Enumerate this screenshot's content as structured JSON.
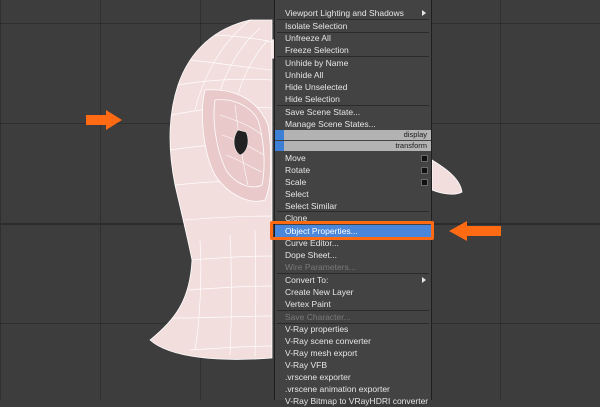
{
  "colors": {
    "menu_bg": "#434343",
    "menu_text": "#e6e6e6",
    "disabled_text": "#7a7a7a",
    "highlight": "#4a86d9",
    "quad_header": "#b3b3b3",
    "annotation": "#ff6a13",
    "viewport_bg": "#3d3d3d"
  },
  "viewport": {
    "model": "wireframe-head-icon"
  },
  "menu": {
    "items": {
      "viewport_lighting": "Viewport Lighting and Shadows",
      "isolate_selection": "Isolate Selection",
      "unfreeze_all": "Unfreeze All",
      "freeze_selection": "Freeze Selection",
      "unhide_by_name": "Unhide by Name",
      "unhide_all": "Unhide All",
      "hide_unselected": "Hide Unselected",
      "hide_selection": "Hide Selection",
      "save_scene_state": "Save Scene State...",
      "manage_scene_states": "Manage Scene States...",
      "move": "Move",
      "rotate": "Rotate",
      "scale": "Scale",
      "select": "Select",
      "select_similar": "Select Similar",
      "clone": "Clone",
      "object_properties": "Object Properties...",
      "curve_editor": "Curve Editor...",
      "dope_sheet": "Dope Sheet...",
      "wire_parameters": "Wire Parameters...",
      "convert_to": "Convert To:",
      "create_new_layer": "Create New Layer",
      "vertex_paint": "Vertex Paint",
      "save_character": "Save Character...",
      "vray_properties": "V-Ray properties",
      "vray_scene_converter": "V-Ray scene converter",
      "vray_mesh_export": "V-Ray mesh export",
      "vray_vfb": "V-Ray VFB",
      "vrscene_exporter": ".vrscene exporter",
      "vrscene_animation_exporter": ".vrscene animation exporter",
      "vray_bitmap_converter": "V-Ray Bitmap to VRayHDRI converter"
    },
    "quad_headers": {
      "display": "display",
      "transform": "transform"
    }
  }
}
